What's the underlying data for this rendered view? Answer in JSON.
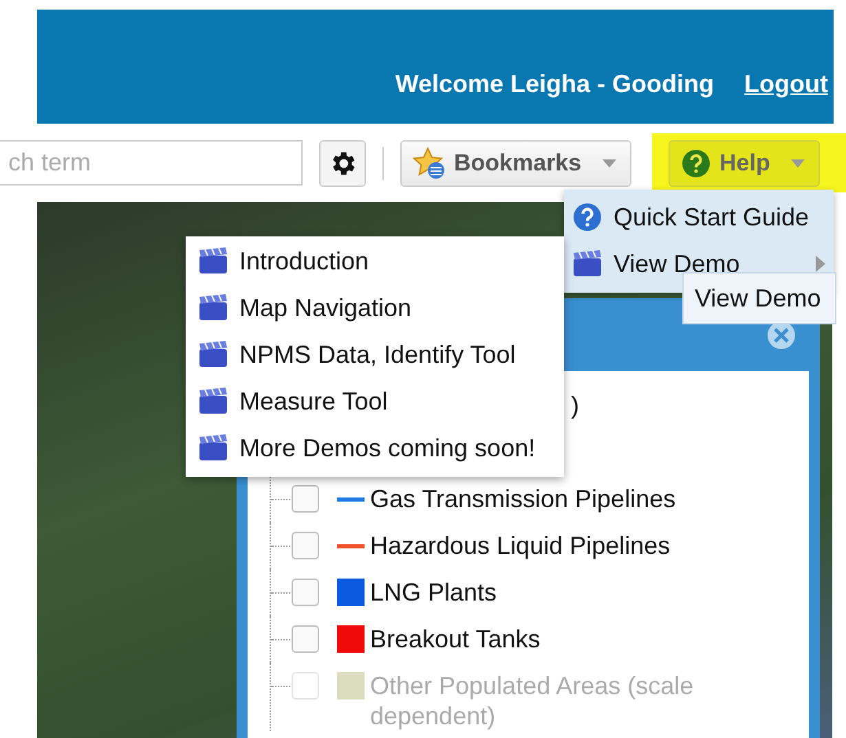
{
  "header": {
    "welcome": "Welcome Leigha - Gooding",
    "logout": "Logout"
  },
  "toolbar": {
    "search": {
      "placeholder": "ch term"
    },
    "bookmarks": "Bookmarks",
    "help": {
      "label": "Help",
      "highlighted": true
    }
  },
  "help_menu": {
    "items": [
      {
        "kind": "guide",
        "label": "Quick Start Guide",
        "has_submenu": false
      },
      {
        "kind": "demo",
        "label": "View Demo",
        "has_submenu": true
      }
    ]
  },
  "tooltip": "View Demo",
  "demo_menu": {
    "items": [
      "Introduction",
      "Map Navigation",
      "NPMS Data, Identify Tool",
      "Measure Tool",
      "More Demos coming soon!"
    ]
  },
  "layers_panel": {
    "heading_fragment": ")",
    "layers": [
      {
        "kind": "line",
        "label": "Gas Transmission Pipelines",
        "color": "#1e7be6",
        "checked": false,
        "disabled": false
      },
      {
        "kind": "line",
        "label": "Hazardous Liquid Pipelines",
        "color": "#f0502a",
        "checked": false,
        "disabled": false
      },
      {
        "kind": "square",
        "label": "LNG Plants",
        "color": "#0a5ae0",
        "checked": false,
        "disabled": false
      },
      {
        "kind": "square",
        "label": "Breakout Tanks",
        "color": "#f00a0a",
        "checked": false,
        "disabled": false
      },
      {
        "kind": "square",
        "label": "Other Populated Areas (scale dependent)",
        "color": "#dcdcc0",
        "checked": false,
        "disabled": true
      }
    ]
  }
}
